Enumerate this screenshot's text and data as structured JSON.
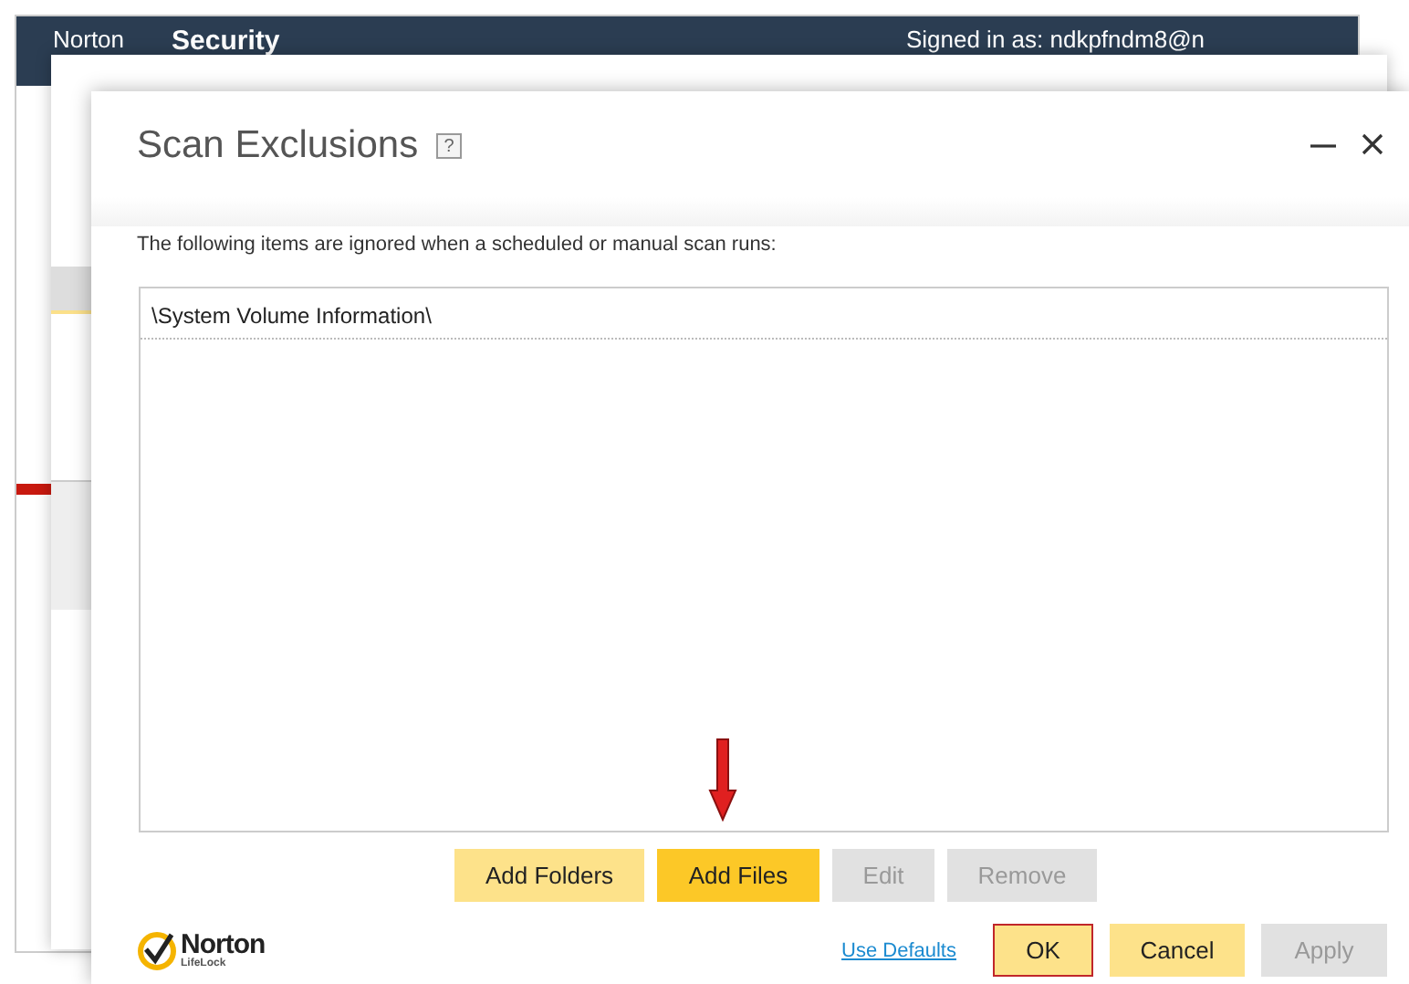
{
  "back_window": {
    "brand": "Norton",
    "title": "Security",
    "signed_in": "Signed in as: ndkpfndm8@n"
  },
  "dialog": {
    "title": "Scan Exclusions",
    "help": "?",
    "description": "The following items are ignored when a scheduled or manual scan runs:",
    "items": [
      {
        "path": "\\System Volume Information\\"
      }
    ],
    "list_buttons": [
      {
        "label": "Add Folders",
        "disabled": false,
        "highlighted": false
      },
      {
        "label": "Add Files",
        "disabled": false,
        "highlighted": true
      },
      {
        "label": "Edit",
        "disabled": true,
        "highlighted": false
      },
      {
        "label": "Remove",
        "disabled": true,
        "highlighted": false
      }
    ],
    "logo": {
      "brand": "Norton",
      "sub": "LifeLock"
    },
    "link": "Use Defaults",
    "footer_buttons": [
      {
        "label": "OK",
        "disabled": false,
        "focused": true
      },
      {
        "label": "Cancel",
        "disabled": false,
        "focused": false
      },
      {
        "label": "Apply",
        "disabled": true,
        "focused": false
      }
    ]
  }
}
